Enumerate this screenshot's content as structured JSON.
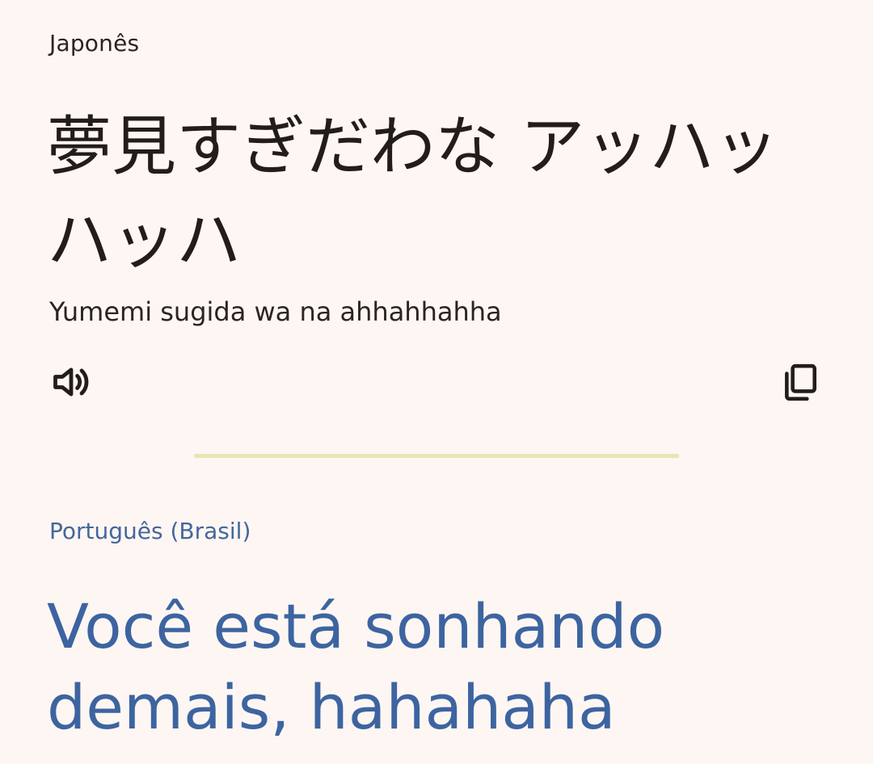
{
  "source": {
    "language": "Japonês",
    "text": "夢見すぎだわな アッハッハッハ",
    "romanization": "Yumemi sugida wa na ahhahhahha"
  },
  "target": {
    "language": "Português (Brasil)",
    "text": "Você está sonhando demais, hahahaha"
  },
  "icons": {
    "listen": "speaker-icon",
    "copy": "copy-icon"
  },
  "colors": {
    "background": "#fdf6f3",
    "source_text": "#221d1b",
    "target_text": "#3d64a0",
    "divider": "#e4e7b4"
  }
}
